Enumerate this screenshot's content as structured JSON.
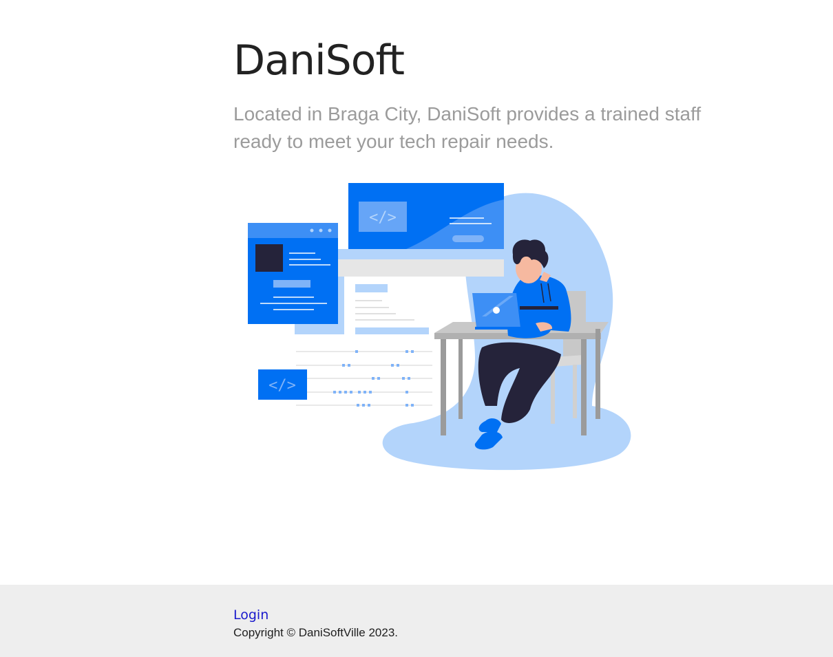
{
  "hero": {
    "title": "DaniSoft",
    "tagline": "Located in Braga City, DaniSoft provides a trained staff ready to meet your tech repair needs."
  },
  "illustration": {
    "icon": "developer-at-desk-illustration",
    "colors": {
      "primary": "#0070f3",
      "light": "#b3d4fb",
      "dark": "#25233a",
      "skin": "#f6b9a0",
      "gray": "#9b9b9b"
    }
  },
  "footer": {
    "login_label": "Login",
    "copyright": "Copyright © DaniSoftVille 2023."
  }
}
